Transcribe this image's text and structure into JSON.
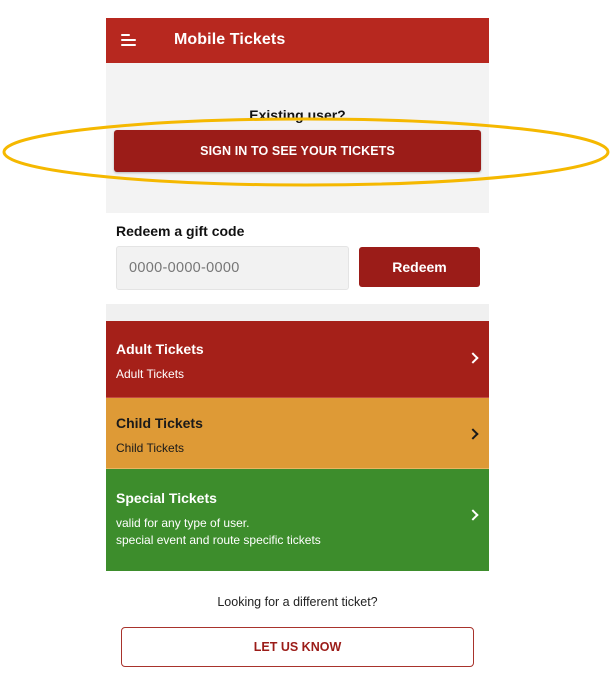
{
  "header": {
    "title": "Mobile Tickets",
    "menu_icon": "hamburger-menu-icon",
    "background_color": "#b7281f"
  },
  "signin": {
    "prompt": "Existing user?",
    "button_label": "SIGN IN TO SEE YOUR TICKETS"
  },
  "redeem": {
    "title": "Redeem a gift code",
    "input_placeholder": "0000-0000-0000",
    "input_value": "",
    "button_label": "Redeem"
  },
  "tickets": [
    {
      "title": "Adult Tickets",
      "description": "Adult Tickets",
      "color": "#a52019"
    },
    {
      "title": "Child Tickets",
      "description": "Child Tickets",
      "color": "#de9a36"
    },
    {
      "title": "Special Tickets",
      "description_lines": [
        "valid for any type of user.",
        "special event and route specific tickets"
      ],
      "color": "#3d8d2c"
    }
  ],
  "footer": {
    "prompt": "Looking for a different ticket?",
    "button_label": "LET US KNOW"
  },
  "annotation": {
    "highlight_color": "#f5b800"
  }
}
